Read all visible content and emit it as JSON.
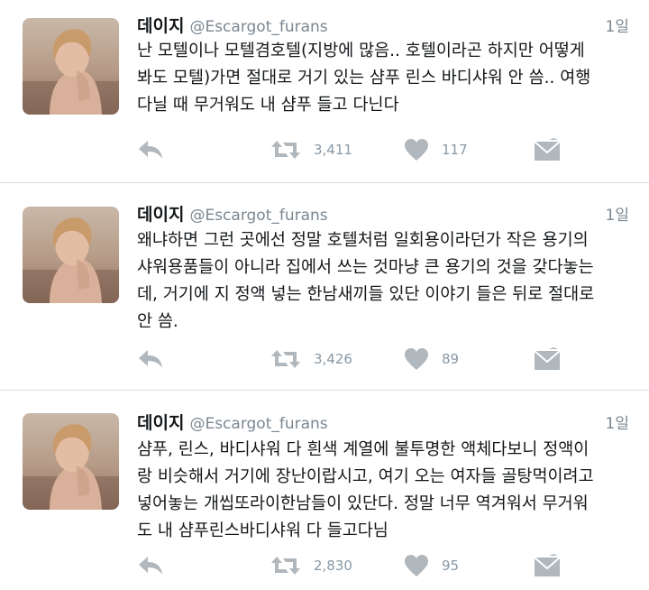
{
  "colors": {
    "icon_gray": "#b0b7bd",
    "text_gray": "#7b8791",
    "divider": "#d9dde0"
  },
  "icons": {
    "reply": "reply-arrow-icon",
    "retweet": "retweet-icon",
    "like": "heart-icon",
    "dm": "envelope-icon"
  },
  "tweets": [
    {
      "name": "데이지",
      "handle": "@Escargot_furans",
      "time": "1일",
      "text": "난 모텔이나 모텔겸호텔(지방에 많음.. 호텔이라곤 하지만 어떻게\n봐도 모텔)가면 절대로 거기 있는 샴푸 린스 바디샤워 안 씀.. 여행\n다닐 때 무거워도 내 샴푸 들고 다닌다",
      "retweets": "3,411",
      "likes": "117"
    },
    {
      "name": "데이지",
      "handle": "@Escargot_furans",
      "time": "1일",
      "text": "왜냐하면 그런 곳에선 정말 호텔처럼 일회용이라던가 작은 용기의\n샤워용품들이 아니라 집에서 쓰는 것마냥 큰 용기의 것을 갖다놓는\n데, 거기에 지 정액 넣는 한남새끼들 있단 이야기 들은 뒤로 절대로\n안 씀.",
      "retweets": "3,426",
      "likes": "89"
    },
    {
      "name": "데이지",
      "handle": "@Escargot_furans",
      "time": "1일",
      "text": "샴푸, 린스, 바디샤워 다 흰색 계열에 불투명한 액체다보니 정액이\n랑 비슷해서 거기에 장난이랍시고, 여기 오는 여자들 골탕먹이려고\n넣어놓는 개씹또라이한남들이 있단다. 정말 너무 역겨워서 무거워\n도 내 샴푸린스바디샤워 다 들고다님",
      "retweets": "2,830",
      "likes": "95"
    }
  ]
}
